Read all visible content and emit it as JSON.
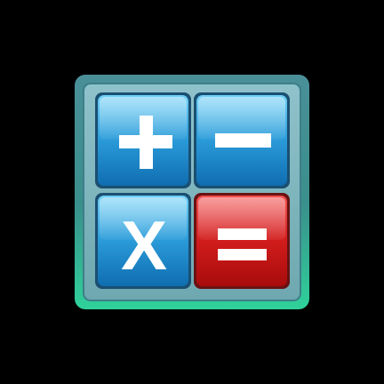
{
  "app_icon": {
    "name": "calculator-app-icon",
    "frame_colors": {
      "outer_top": "#4a8f98",
      "outer_bottom": "#2fd19a",
      "inner": "#7fb4bd"
    },
    "keys": [
      {
        "id": "plus",
        "symbol": "+",
        "icon": "plus-icon",
        "color_top": "#5fc6f2",
        "color_bottom": "#1277b9"
      },
      {
        "id": "minus",
        "symbol": "−",
        "icon": "minus-icon",
        "color_top": "#5fc6f2",
        "color_bottom": "#1277b9"
      },
      {
        "id": "multiply",
        "symbol": "X",
        "icon": "multiply-icon",
        "color_top": "#5fc6f2",
        "color_bottom": "#1277b9"
      },
      {
        "id": "equals",
        "symbol": "=",
        "icon": "equals-icon",
        "color_top": "#f04040",
        "color_bottom": "#b40f0f"
      }
    ]
  }
}
